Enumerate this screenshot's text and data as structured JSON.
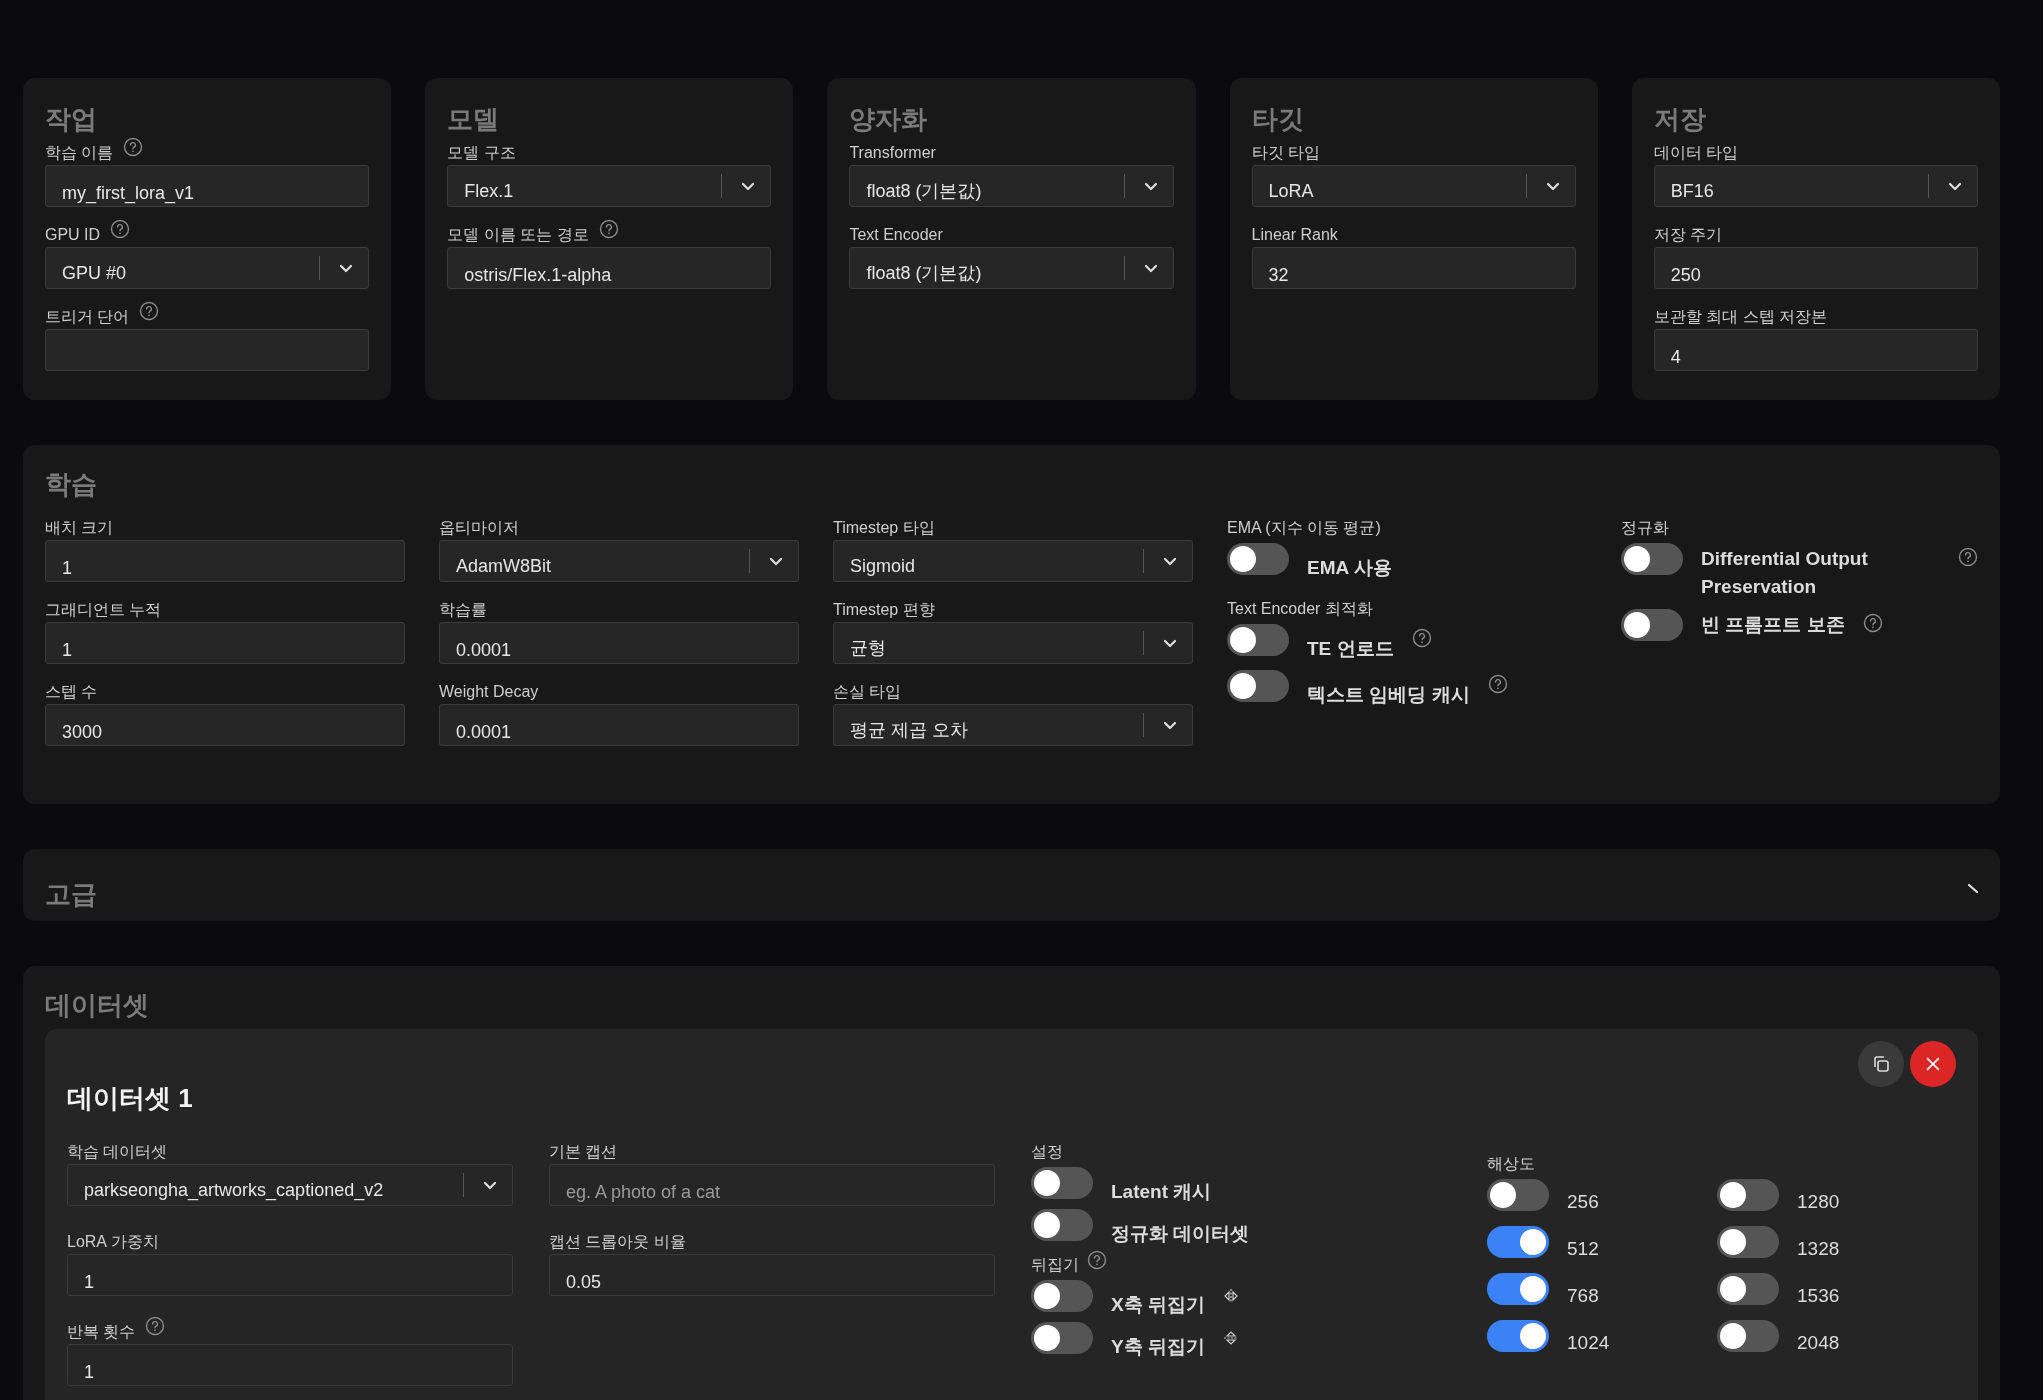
{
  "top_cards": [
    {
      "title": "작업",
      "fields": [
        {
          "label": "학습 이름",
          "help": true,
          "kind": "input",
          "value": "my_first_lora_v1"
        },
        {
          "label": "GPU ID",
          "help": true,
          "kind": "select",
          "value": "GPU #0"
        },
        {
          "label": "트리거 단어",
          "help": true,
          "kind": "input"
        }
      ]
    },
    {
      "title": "모델",
      "fields": [
        {
          "label": "모델 구조",
          "help": false,
          "kind": "select",
          "value": "Flex.1"
        },
        {
          "label": "모델 이름 또는 경로",
          "help": true,
          "kind": "input",
          "value": "ostris/Flex.1-alpha"
        }
      ]
    },
    {
      "title": "양자화",
      "fields": [
        {
          "label": "Transformer",
          "help": false,
          "kind": "select",
          "value": "float8 (기본값)"
        },
        {
          "label": "Text Encoder",
          "help": false,
          "kind": "select",
          "value": "float8 (기본값)"
        }
      ]
    },
    {
      "title": "타깃",
      "fields": [
        {
          "label": "타깃 타입",
          "help": false,
          "kind": "select",
          "value": "LoRA"
        },
        {
          "label": "Linear Rank",
          "help": false,
          "kind": "input",
          "value": "32"
        }
      ]
    },
    {
      "title": "저장",
      "fields": [
        {
          "label": "데이터 타입",
          "help": false,
          "kind": "select",
          "value": "BF16"
        },
        {
          "label": "저장 주기",
          "help": false,
          "kind": "input",
          "value": "250"
        },
        {
          "label": "보관할 최대 스텝 저장본",
          "help": false,
          "kind": "input",
          "value": "4"
        }
      ]
    }
  ],
  "training": {
    "title": "학습",
    "field_columns": [
      {
        "fields": [
          {
            "label": "배치 크기",
            "help": false,
            "kind": "input",
            "value": "1"
          },
          {
            "label": "그래디언트 누적",
            "help": false,
            "kind": "input",
            "value": "1"
          },
          {
            "label": "스텝 수",
            "help": false,
            "kind": "input",
            "value": "3000"
          }
        ]
      },
      {
        "fields": [
          {
            "label": "옵티마이저",
            "help": false,
            "kind": "select",
            "value": "AdamW8Bit"
          },
          {
            "label": "학습률",
            "help": false,
            "kind": "input",
            "value": "0.0001"
          },
          {
            "label": "Weight Decay",
            "help": false,
            "kind": "input",
            "value": "0.0001"
          }
        ]
      },
      {
        "fields": [
          {
            "label": "Timestep 타입",
            "help": false,
            "kind": "select",
            "value": "Sigmoid"
          },
          {
            "label": "Timestep 편향",
            "help": false,
            "kind": "select",
            "value": "균형"
          },
          {
            "label": "손실 타입",
            "help": false,
            "kind": "select",
            "value": "평균 제곱 오차"
          }
        ]
      }
    ],
    "toggle_columns": [
      {
        "groups": [
          {
            "label": "EMA (지수 이동 평균)",
            "toggles": [
              {
                "label": "EMA 사용",
                "on": false,
                "help": false
              }
            ]
          },
          {
            "label": "Text Encoder 최적화",
            "toggles": [
              {
                "label": "TE 언로드",
                "on": false,
                "help": true
              },
              {
                "label": "텍스트 임베딩 캐시",
                "on": false,
                "help": true
              }
            ]
          }
        ]
      },
      {
        "groups": [
          {
            "label": "정규화",
            "toggles": [
              {
                "label": "Differential Output Preservation",
                "on": false,
                "help": true
              },
              {
                "label": "빈 프롬프트 보존",
                "on": false,
                "help": true
              }
            ]
          }
        ]
      }
    ]
  },
  "advanced": {
    "title": "고급"
  },
  "dataset": {
    "title": "데이터셋",
    "items": [
      {
        "title": "데이터셋 1",
        "left_fields": [
          {
            "label": "학습 데이터셋",
            "help": false,
            "kind": "select",
            "value": "parkseongha_artworks_captioned_v2"
          },
          {
            "label": "LoRA 가중치",
            "help": false,
            "kind": "input",
            "value": "1"
          },
          {
            "label": "반복 횟수",
            "help": true,
            "kind": "input",
            "value": "1"
          }
        ],
        "mid_fields": [
          {
            "label": "기본 캡션",
            "help": false,
            "kind": "input",
            "placeholder": "eg. A photo of a cat"
          },
          {
            "label": "캡션 드롭아웃 비율",
            "help": false,
            "kind": "input",
            "value": "0.05"
          }
        ],
        "settings": {
          "label": "설정",
          "toggles": [
            {
              "label": "Latent 캐시",
              "on": false,
              "help": false
            },
            {
              "label": "정규화 데이터셋",
              "on": false,
              "help": false
            }
          ]
        },
        "flip": {
          "label": "뒤집기",
          "help": true,
          "toggles": [
            {
              "label": "X축 뒤집기",
              "on": false,
              "help": false,
              "kind": "flip-horizontal"
            },
            {
              "label": "Y축 뒤집기",
              "on": false,
              "help": false,
              "kind": "flip-vertical"
            }
          ]
        },
        "resolution": {
          "label": "해상도",
          "options": [
            {
              "label": "256",
              "on": false
            },
            {
              "label": "512",
              "on": true
            },
            {
              "label": "768",
              "on": true
            },
            {
              "label": "1024",
              "on": true
            },
            {
              "label": "1280",
              "on": false
            },
            {
              "label": "1328",
              "on": false
            },
            {
              "label": "1536",
              "on": false
            },
            {
              "label": "2048",
              "on": false
            }
          ]
        }
      }
    ]
  }
}
